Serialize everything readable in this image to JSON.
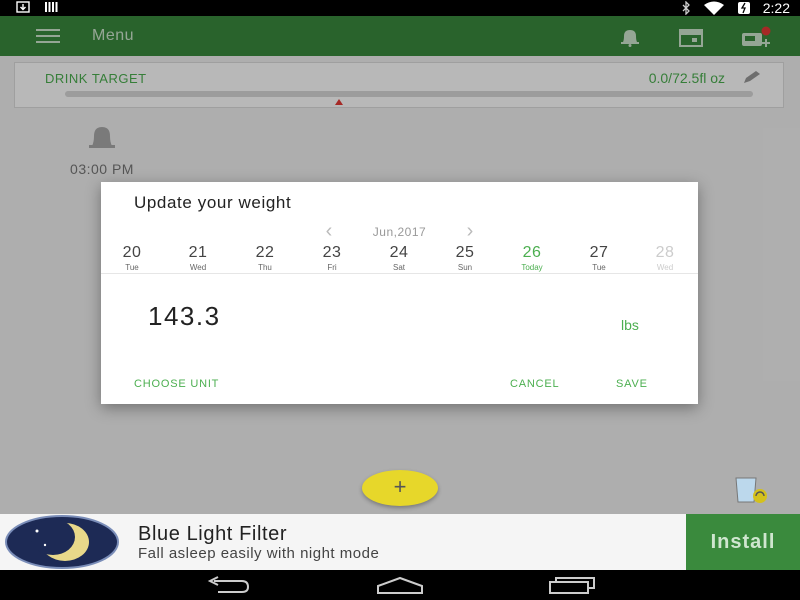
{
  "status_bar": {
    "time": "2:22"
  },
  "app_bar": {
    "title": "Menu"
  },
  "drink_target": {
    "label": "DRINK TARGET",
    "amount": "0.0/72.5fl oz"
  },
  "reminder": {
    "time": "03:00 PM"
  },
  "dialog": {
    "title": "Update your weight",
    "month": "Jun,2017",
    "days": [
      {
        "num": "20",
        "dow": "Tue"
      },
      {
        "num": "21",
        "dow": "Wed"
      },
      {
        "num": "22",
        "dow": "Thu"
      },
      {
        "num": "23",
        "dow": "Fri"
      },
      {
        "num": "24",
        "dow": "Sat"
      },
      {
        "num": "25",
        "dow": "Sun"
      },
      {
        "num": "26",
        "dow": "Today"
      },
      {
        "num": "27",
        "dow": "Tue"
      },
      {
        "num": "28",
        "dow": "Wed"
      }
    ],
    "weight": "143.3",
    "unit": "lbs",
    "choose_unit": "CHOOSE UNIT",
    "cancel": "CANCEL",
    "save": "SAVE"
  },
  "fab": {
    "label": "+"
  },
  "ad": {
    "title": "Blue Light Filter",
    "subtitle": "Fall asleep easily with night mode",
    "install": "Install"
  },
  "colors": {
    "primary": "#3a8a3d",
    "accent": "#4caf50",
    "fab": "#e7d72a"
  },
  "icons": [
    "download-icon",
    "barcode-icon",
    "bluetooth-icon",
    "wifi-icon",
    "battery-icon",
    "menu-icon",
    "bell-icon",
    "calendar-icon",
    "cup-badge-icon",
    "pencil-icon",
    "glass-icon",
    "moon-logo-icon",
    "back-icon",
    "home-icon",
    "recents-icon"
  ]
}
